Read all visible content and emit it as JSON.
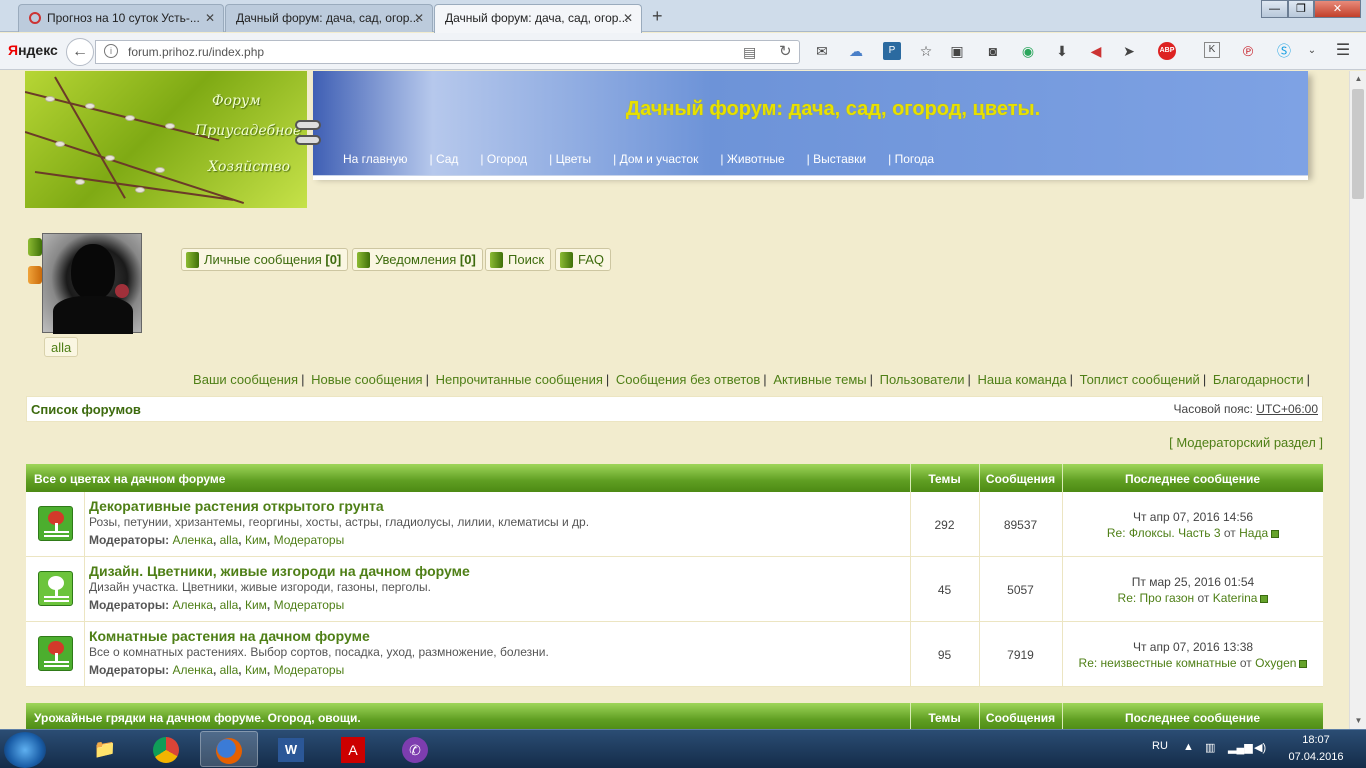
{
  "browser": {
    "tabs": [
      {
        "label": "Прогноз на 10 суток Усть-...",
        "close": "✕"
      },
      {
        "label": "Дачный форум: дача, сад, огор...",
        "close": "✕"
      },
      {
        "label": "Дачный форум: дача, сад, огор...",
        "close": "✕"
      }
    ],
    "new_tab": "+",
    "window_buttons": {
      "minimize": "—",
      "maximize": "❐",
      "close": "✕"
    },
    "brand": {
      "first_letter": "Я",
      "rest": "ндекс"
    },
    "url": "forum.prihoz.ru/index.php",
    "menu_icon": "☰"
  },
  "header": {
    "logo_lines": [
      "Форум",
      "Приусадебное",
      "Хозяйство"
    ],
    "site_title": "Дачный форум: дача, сад, огород, цветы.",
    "nav": [
      "На главную",
      "Сад",
      "Огород",
      "Цветы",
      "Дом и участок",
      "Животные",
      "Выставки",
      "Погода"
    ],
    "nav_separator": "|"
  },
  "user": {
    "username": "alla",
    "buttons": [
      {
        "label": "Личные сообщения",
        "count": "[0]"
      },
      {
        "label": "Уведомления",
        "count": "[0]"
      },
      {
        "label": "Поиск",
        "count": ""
      },
      {
        "label": "FAQ",
        "count": ""
      }
    ]
  },
  "quick_links": [
    "Ваши сообщения",
    "Новые сообщения",
    "Непрочитанные сообщения",
    "Сообщения без ответов",
    "Активные темы",
    "Пользователи",
    "Наша команда",
    "Топлист сообщений",
    "Благодарности"
  ],
  "breadcrumb": "Список форумов",
  "timezone": {
    "label": "Часовой пояс:",
    "value": "UTC+06:00"
  },
  "moderator_section": "[ Модераторский раздел ]",
  "columns": {
    "topics": "Темы",
    "posts": "Сообщения",
    "last_post": "Последнее сообщение"
  },
  "categories": [
    {
      "title": "Все о цветах на дачном форуме",
      "forums": [
        {
          "title": "Декоративные растения открытого грунта",
          "desc": "Розы, петунии, хризантемы, георгины, хосты, астры, гладиолусы, лилии, клематисы и др.",
          "mods_label": "Модераторы:",
          "mods": [
            "Аленка",
            "alla",
            "Ким",
            "Модераторы"
          ],
          "topics": "292",
          "posts": "89537",
          "last_date": "Чт апр 07, 2016 14:56",
          "last_title": "Re: Флоксы. Часть 3",
          "by": "от",
          "last_author": "Нада",
          "icon_color": "#d33a2a"
        },
        {
          "title": "Дизайн. Цветники, живые изгороди на дачном форуме",
          "desc": "Дизайн участка. Цветники, живые изгороди, газоны, перголы.",
          "mods_label": "Модераторы:",
          "mods": [
            "Аленка",
            "alla",
            "Ким",
            "Модераторы"
          ],
          "topics": "45",
          "posts": "5057",
          "last_date": "Пт мар 25, 2016 01:54",
          "last_title": "Re: Про газон",
          "by": "от",
          "last_author": "Katerina",
          "icon_color": "#ffffff"
        },
        {
          "title": "Комнатные растения на дачном форуме",
          "desc": "Все о комнатных растениях. Выбор сортов, посадка, уход, размножение, болезни.",
          "mods_label": "Модераторы:",
          "mods": [
            "Аленка",
            "alla",
            "Ким",
            "Модераторы"
          ],
          "topics": "95",
          "posts": "7919",
          "last_date": "Чт апр 07, 2016 13:38",
          "last_title": "Re: неизвестные комнатные",
          "by": "от",
          "last_author": "Oxygen",
          "icon_color": "#d33a2a"
        }
      ]
    },
    {
      "title": "Урожайные грядки на дачном форуме. Огород, овощи."
    }
  ],
  "taskbar": {
    "lang": "RU",
    "time": "18:07",
    "date": "07.04.2016"
  }
}
